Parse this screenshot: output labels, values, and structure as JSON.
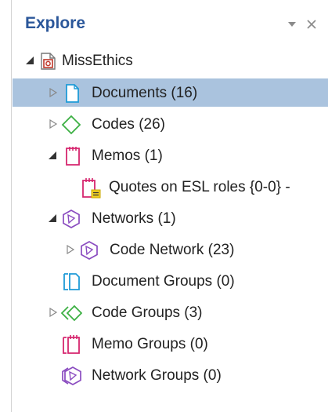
{
  "panel": {
    "title": "Explore",
    "dropdown_icon": "chevron-down-icon",
    "close_icon": "close-icon"
  },
  "colors": {
    "title": "#2b579a",
    "selection": "#aac3de",
    "document": "#1f9bd7",
    "code": "#3cb043",
    "memo": "#d6266e",
    "network": "#8a4cc0",
    "project": "#c0392b"
  },
  "tree": {
    "project": {
      "label": "MissEthics",
      "expanded": true,
      "icon": "project-icon"
    },
    "documents": {
      "label": "Documents (16)",
      "expanded": false,
      "selected": true,
      "icon": "document-icon"
    },
    "codes": {
      "label": "Codes (26)",
      "expanded": false,
      "icon": "code-icon"
    },
    "memos": {
      "label": "Memos (1)",
      "expanded": true,
      "icon": "memo-icon"
    },
    "memo_item": {
      "label": "Quotes on ESL roles {0-0} -",
      "icon": "memo-note-icon"
    },
    "networks": {
      "label": "Networks (1)",
      "expanded": true,
      "icon": "network-icon"
    },
    "network_item": {
      "label": "Code Network (23)",
      "expanded": false,
      "icon": "network-icon"
    },
    "document_groups": {
      "label": "Document Groups (0)",
      "icon": "document-group-icon"
    },
    "code_groups": {
      "label": "Code Groups (3)",
      "expanded": false,
      "icon": "code-group-icon"
    },
    "memo_groups": {
      "label": "Memo Groups (0)",
      "icon": "memo-group-icon"
    },
    "network_groups": {
      "label": "Network Groups (0)",
      "icon": "network-group-icon"
    }
  }
}
